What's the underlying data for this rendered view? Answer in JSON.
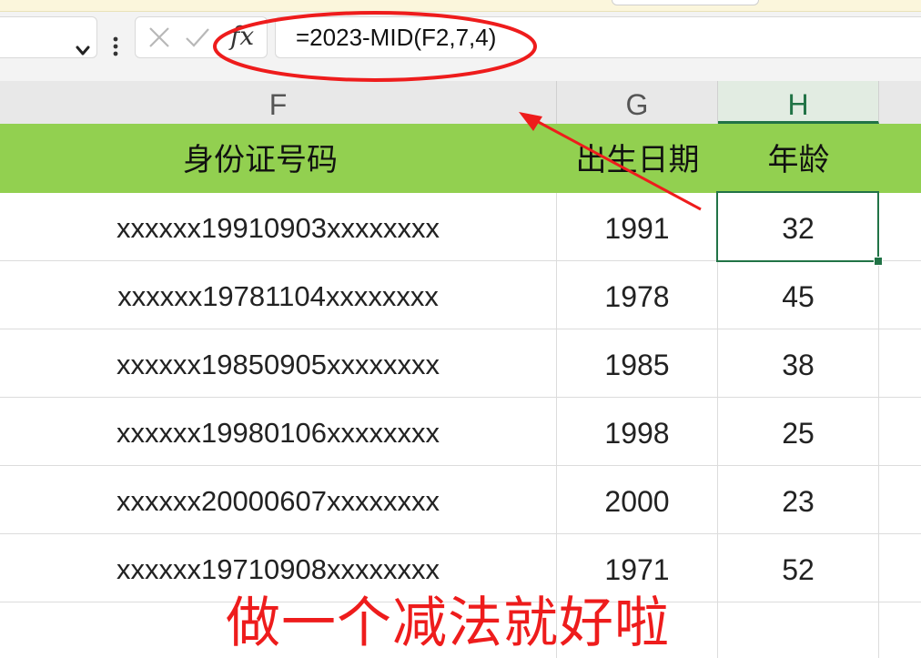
{
  "formula_bar": {
    "fx_label": "fx",
    "formula": "=2023-MID(F2,7,4)"
  },
  "columns": [
    {
      "letter": "F"
    },
    {
      "letter": "G"
    },
    {
      "letter": "H"
    }
  ],
  "header": {
    "id_label": "身份证号码",
    "birth_label": "出生日期",
    "age_label": "年龄"
  },
  "rows": [
    {
      "id": "xxxxxx19910903xxxxxxxx",
      "year": "1991",
      "age": "32"
    },
    {
      "id": "xxxxxx19781104xxxxxxxx",
      "year": "1978",
      "age": "45"
    },
    {
      "id": "xxxxxx19850905xxxxxxxx",
      "year": "1985",
      "age": "38"
    },
    {
      "id": "xxxxxx19980106xxxxxxxx",
      "year": "1998",
      "age": "25"
    },
    {
      "id": "xxxxxx20000607xxxxxxxx",
      "year": "2000",
      "age": "23"
    },
    {
      "id": "xxxxxx19710908xxxxxxxx",
      "year": "1971",
      "age": "52"
    }
  ],
  "annotation": {
    "caption": "做一个减法就好啦",
    "color": "#ee1c1c"
  },
  "colors": {
    "header_fill": "#92d050",
    "selection": "#217346"
  }
}
